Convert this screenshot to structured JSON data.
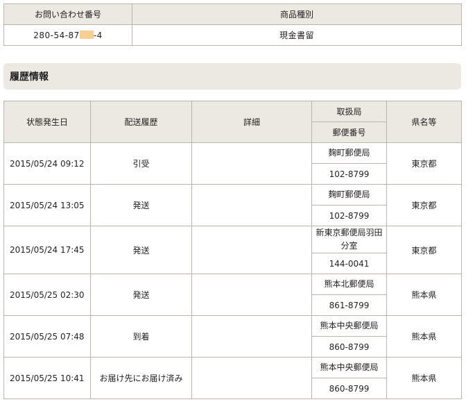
{
  "summary": {
    "headers": [
      "お問い合わせ番号",
      "商品種別"
    ],
    "tracking_number_prefix": "280-54-87",
    "tracking_number_suffix": "-4",
    "product_type": "現金書留"
  },
  "history": {
    "heading": "履歴情報",
    "headers": {
      "date": "状態発生日",
      "status": "配送履歴",
      "detail": "詳細",
      "office": "取扱局",
      "postal_code": "郵便番号",
      "prefecture": "県名等"
    },
    "rows": [
      {
        "date": "2015/05/24 09:12",
        "status": "引受",
        "detail": "",
        "office": "麹町郵便局",
        "postal_code": "102-8799",
        "prefecture": "東京都"
      },
      {
        "date": "2015/05/24 13:05",
        "status": "発送",
        "detail": "",
        "office": "麹町郵便局",
        "postal_code": "102-8799",
        "prefecture": "東京都"
      },
      {
        "date": "2015/05/24 17:45",
        "status": "発送",
        "detail": "",
        "office": "新東京郵便局羽田分室",
        "postal_code": "144-0041",
        "prefecture": "東京都"
      },
      {
        "date": "2015/05/25 02:30",
        "status": "発送",
        "detail": "",
        "office": "熊本北郵便局",
        "postal_code": "861-8799",
        "prefecture": "熊本県"
      },
      {
        "date": "2015/05/25 07:48",
        "status": "到着",
        "detail": "",
        "office": "熊本中央郵便局",
        "postal_code": "860-8799",
        "prefecture": "熊本県"
      },
      {
        "date": "2015/05/25 10:41",
        "status": "お届け先にお届け済み",
        "detail": "",
        "office": "熊本中央郵便局",
        "postal_code": "860-8799",
        "prefecture": "熊本県"
      }
    ]
  },
  "colors": {
    "header_background": "#ece8e2",
    "border": "#b9b4ac",
    "masked_digits": "#f7cf93"
  }
}
